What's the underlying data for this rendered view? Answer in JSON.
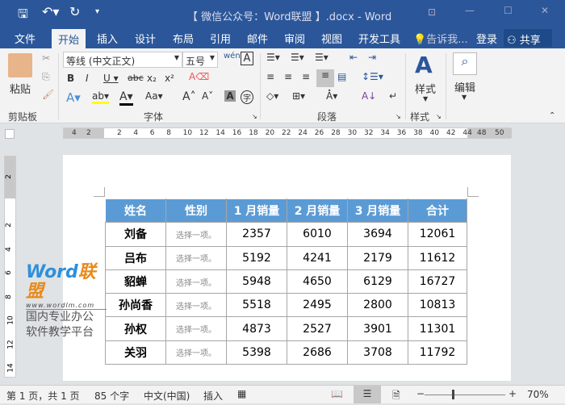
{
  "title": "【 微信公众号：Word联盟 】.docx - Word",
  "tabs": [
    "文件",
    "开始",
    "插入",
    "设计",
    "布局",
    "引用",
    "邮件",
    "审阅",
    "视图",
    "开发工具"
  ],
  "tell_me": "告诉我...",
  "login": "登录",
  "share": "共享",
  "ribbon": {
    "paste": "粘贴",
    "clipboard": "剪贴板",
    "font_name": "等线 (中文正文)",
    "font_size": "五号",
    "font_group": "字体",
    "paragraph": "段落",
    "styles": "样式",
    "styles_group": "样式",
    "edit": "编辑"
  },
  "ruler": {
    "h_left": [
      "4",
      "2"
    ],
    "h": [
      "2",
      "4",
      "6",
      "8",
      "10",
      "12",
      "14",
      "16",
      "18",
      "20",
      "22",
      "24",
      "26",
      "28",
      "30",
      "32",
      "34",
      "36",
      "38",
      "40",
      "42",
      "44"
    ],
    "h_right": [
      "48",
      "50"
    ],
    "v": [
      "2",
      "2",
      "4",
      "6",
      "8",
      "10",
      "12",
      "14"
    ]
  },
  "watermark": {
    "logo": "Word联盟",
    "url": "www.wordlm.com",
    "line1": "国内专业办公",
    "line2": "软件教学平台"
  },
  "table": {
    "headers": [
      "姓名",
      "性别",
      "1 月销量",
      "2 月销量",
      "3 月销量",
      "合计"
    ],
    "rows": [
      [
        "刘备",
        "选择一项。",
        "2357",
        "6010",
        "3694",
        "12061"
      ],
      [
        "吕布",
        "选择一项。",
        "5192",
        "4241",
        "2179",
        "11612"
      ],
      [
        "貂蝉",
        "选择一项。",
        "5948",
        "4650",
        "6129",
        "16727"
      ],
      [
        "孙尚香",
        "选择一项。",
        "5518",
        "2495",
        "2800",
        "10813"
      ],
      [
        "孙权",
        "选择一项。",
        "4873",
        "2527",
        "3901",
        "11301"
      ],
      [
        "关羽",
        "选择一项。",
        "5398",
        "2686",
        "3708",
        "11792"
      ]
    ]
  },
  "status": {
    "page": "第 1 页，共 1 页",
    "words": "85 个字",
    "lang": "中文(中国)",
    "mode": "插入",
    "zoom": "70%"
  },
  "colors": {
    "brand": "#2b579a",
    "header": "#5b9bd5"
  }
}
